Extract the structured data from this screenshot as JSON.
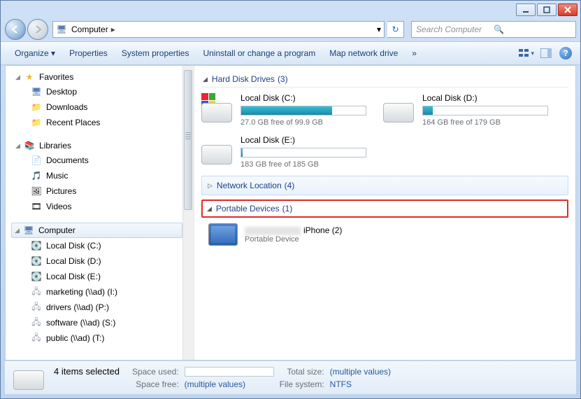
{
  "titlebar": {
    "min": "–",
    "max": "▭",
    "close": "✕"
  },
  "nav": {
    "location": "Computer",
    "dropdown": "▾",
    "search_placeholder": "Search Computer"
  },
  "cmdbar": {
    "organize": "Organize ▾",
    "properties": "Properties",
    "system_properties": "System properties",
    "uninstall": "Uninstall or change a program",
    "map_drive": "Map network drive",
    "more": "»"
  },
  "sidebar": {
    "favorites": {
      "label": "Favorites",
      "items": [
        {
          "label": "Desktop"
        },
        {
          "label": "Downloads"
        },
        {
          "label": "Recent Places"
        }
      ]
    },
    "libraries": {
      "label": "Libraries",
      "items": [
        {
          "label": "Documents"
        },
        {
          "label": "Music"
        },
        {
          "label": "Pictures"
        },
        {
          "label": "Videos"
        }
      ]
    },
    "computer": {
      "label": "Computer",
      "items": [
        {
          "label": "Local Disk (C:)"
        },
        {
          "label": "Local Disk (D:)"
        },
        {
          "label": "Local Disk (E:)"
        },
        {
          "label": "marketing (\\\\ad) (I:)"
        },
        {
          "label": "drivers (\\\\ad) (P:)"
        },
        {
          "label": "software (\\\\ad) (S:)"
        },
        {
          "label": "public (\\\\ad) (T:)"
        }
      ]
    }
  },
  "content": {
    "hdd": {
      "head": "Hard Disk Drives",
      "count": "(3)"
    },
    "drives": [
      {
        "name": "Local Disk (C:)",
        "free": "27.0 GB free of 99.9 GB",
        "fill": 73,
        "win": true
      },
      {
        "name": "Local Disk (D:)",
        "free": "164 GB free of 179 GB",
        "fill": 8,
        "win": false
      },
      {
        "name": "Local Disk (E:)",
        "free": "183 GB free of 185 GB",
        "fill": 1,
        "win": false
      }
    ],
    "network": {
      "head": "Network Location",
      "count": "(4)"
    },
    "portable": {
      "head": "Portable Devices",
      "count": "(1)"
    },
    "device": {
      "name": "iPhone (2)",
      "sub": "Portable Device"
    }
  },
  "status": {
    "selected": "4 items selected",
    "space_used_lbl": "Space used:",
    "space_free_lbl": "Space free:",
    "space_free_val": "(multiple values)",
    "total_lbl": "Total size:",
    "total_val": "(multiple values)",
    "fs_lbl": "File system:",
    "fs_val": "NTFS"
  }
}
